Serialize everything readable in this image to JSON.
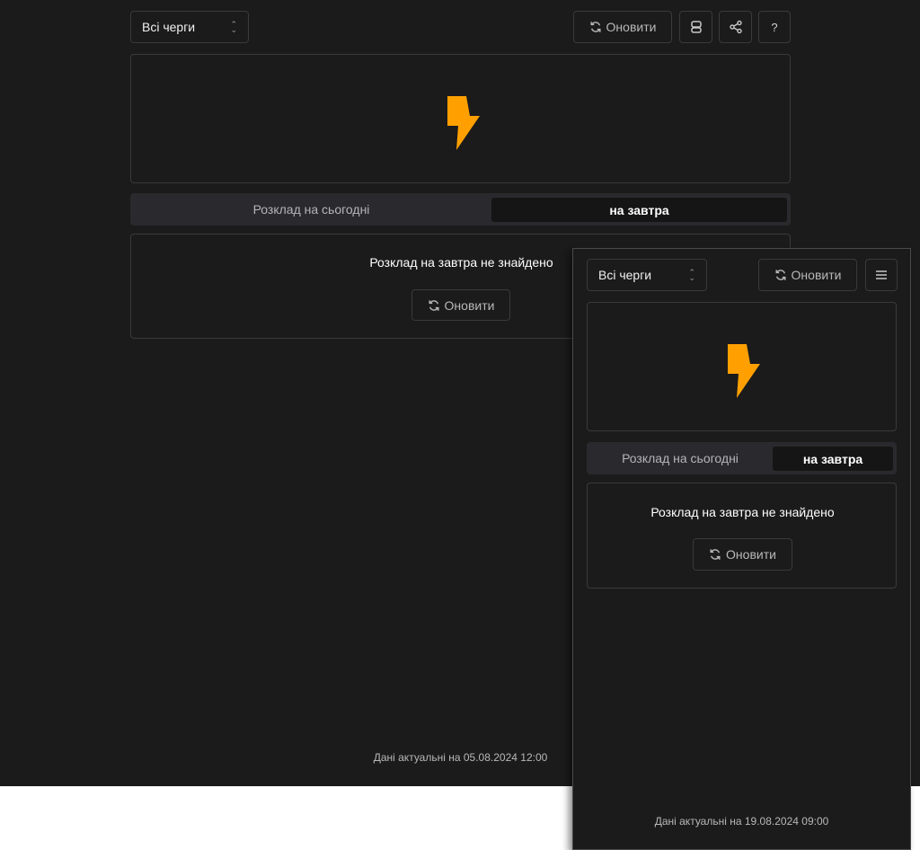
{
  "desktop": {
    "queue_select": "Всі черги",
    "refresh_label": "Оновити",
    "help_label": "?",
    "tabs": {
      "today": "Розклад на сьогодні",
      "tomorrow": "на завтра"
    },
    "empty_message": "Розклад на завтра не знайдено",
    "empty_refresh_label": "Оновити",
    "footer": "Дані актуальні на 05.08.2024 12:00"
  },
  "mobile": {
    "queue_select": "Всі черги",
    "refresh_label": "Оновити",
    "tabs": {
      "today": "Розклад на сьогодні",
      "tomorrow": "на завтра"
    },
    "empty_message": "Розклад на завтра не знайдено",
    "empty_refresh_label": "Оновити",
    "footer": "Дані актуальні на 19.08.2024 09:00"
  },
  "colors": {
    "background": "#1b1b1b",
    "accent": "#ffa000",
    "border": "#3a3a3a"
  },
  "icons": [
    "refresh-icon",
    "robot-icon",
    "share-icon",
    "menu-icon",
    "lightning-icon"
  ]
}
